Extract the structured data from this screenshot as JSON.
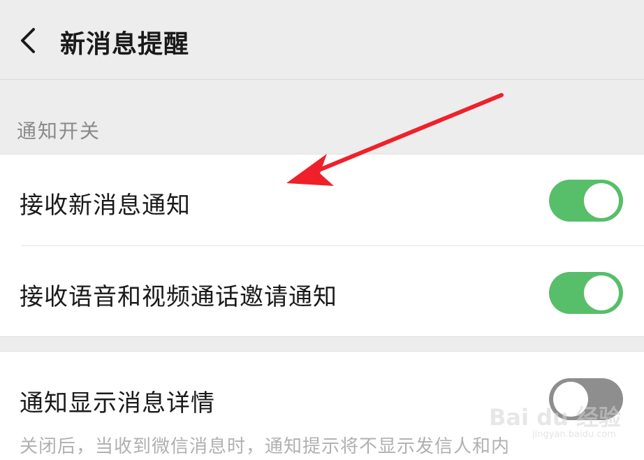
{
  "header": {
    "title": "新消息提醒",
    "back_icon": "chevron-left-icon"
  },
  "section": {
    "label": "通知开关"
  },
  "settings": {
    "receive_new_message": {
      "label": "接收新消息通知",
      "enabled": true
    },
    "receive_call_invite": {
      "label": "接收语音和视频通话邀请通知",
      "enabled": true
    },
    "show_message_detail": {
      "label": "通知显示消息详情",
      "enabled": false,
      "description": "关闭后，当收到微信消息时，通知提示将不显示发信人和内"
    }
  },
  "watermark": {
    "text": "Bai du 经验",
    "sub": "jingyan.baidu.com"
  },
  "colors": {
    "toggle_on": "#57be6a",
    "toggle_off": "#8e8e8e",
    "annotation_arrow": "#f0202a"
  }
}
